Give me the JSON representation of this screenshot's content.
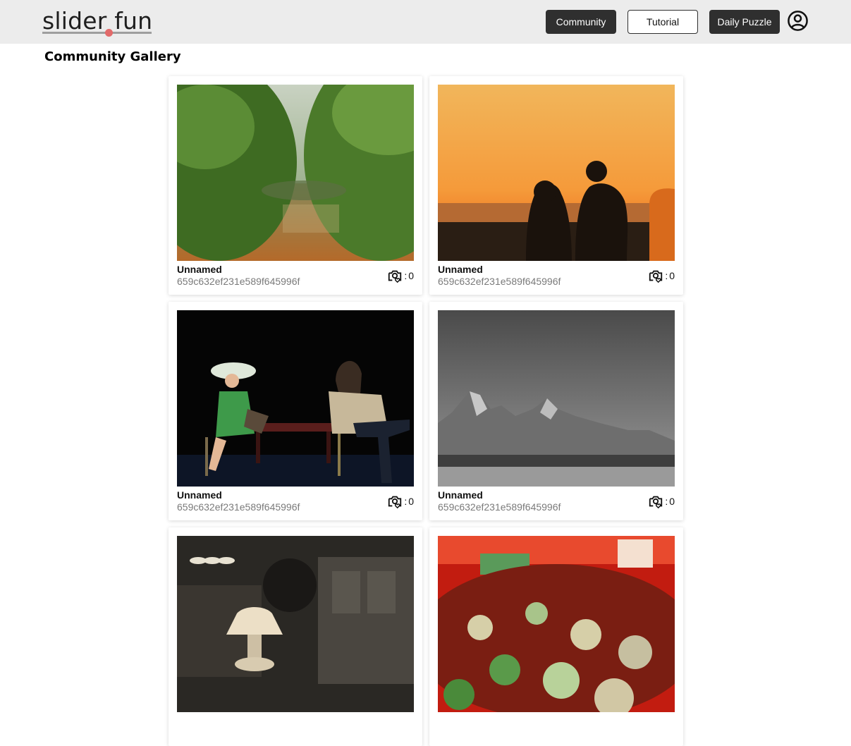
{
  "app": {
    "logo_text": "slider fun"
  },
  "nav": {
    "community_label": "Community",
    "tutorial_label": "Tutorial",
    "daily_label": "Daily Puzzle"
  },
  "page": {
    "title": "Community Gallery"
  },
  "gallery": [
    {
      "name": "Unnamed",
      "id": "659c632ef231e589f645996f",
      "likes": "0",
      "image": "mangrove-waterway"
    },
    {
      "name": "Unnamed",
      "id": "659c632ef231e589f645996f",
      "likes": "0",
      "image": "sunset-couple-silhouette"
    },
    {
      "name": "Unnamed",
      "id": "659c632ef231e589f645996f",
      "likes": "0",
      "image": "stage-performers"
    },
    {
      "name": "Unnamed",
      "id": "659c632ef231e589f645996f",
      "likes": "0",
      "image": "mountain-landscape-bw"
    },
    {
      "name": "",
      "id": "",
      "likes": "",
      "image": "vintage-room-lamp"
    },
    {
      "name": "",
      "id": "",
      "likes": "",
      "image": "crowd-party-red"
    }
  ],
  "icons": {
    "user": "user-circle-icon",
    "likes": "camera-heart-icon"
  },
  "colors": {
    "topbar": "#ececec",
    "button_dark": "#2f2f2f",
    "logo_dot": "#e26a6a",
    "id_text": "#7a7a7a"
  }
}
